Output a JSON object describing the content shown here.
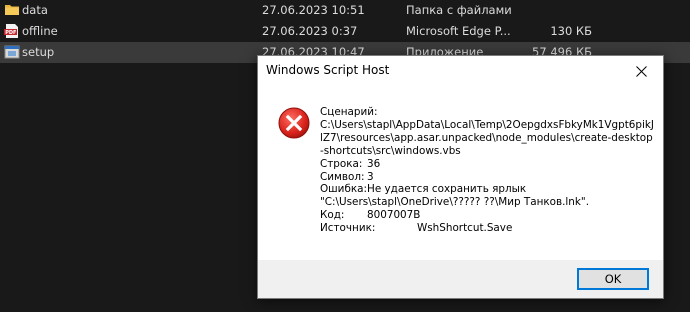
{
  "explorer": {
    "rows": [
      {
        "name": "data",
        "date": "27.06.2023 10:51",
        "type": "Папка с файлами",
        "size": "",
        "icon": "folder-icon"
      },
      {
        "name": "offline",
        "date": "27.06.2023 0:37",
        "type": "Microsoft Edge P...",
        "size": "130 КБ",
        "icon": "pdf-icon"
      },
      {
        "name": "setup",
        "date": "27.06.2023 10:47",
        "type": "Приложение",
        "size": "57 496 КБ",
        "icon": "setup-app-icon"
      }
    ]
  },
  "dialog": {
    "title": "Windows Script Host",
    "scenario_label": "Сценарий:",
    "script_path": "C:\\Users\\stapl\\AppData\\Local\\Temp\\2OepgdxsFbkyMk1Vgpt6pikJlZ7\\resources\\app.asar.unpacked\\node_modules\\create-desktop-shortcuts\\src\\windows.vbs",
    "line_label": "Строка:",
    "line_value": "36",
    "char_label": "Символ:",
    "char_value": "3",
    "error_label": "Ошибка:",
    "error_text": "Не удается сохранить ярлык",
    "error_path": "\"C:\\Users\\stapl\\OneDrive\\????? ??\\Мир Танков.lnk\".",
    "code_label": "Код:",
    "code_value": "8007007B",
    "source_label": "Источник:",
    "source_value": "WshShortcut.Save",
    "ok_label": "OK"
  },
  "colors": {
    "explorer_bg": "#191919",
    "selected_row": "#3a3a3a",
    "error_red": "#e81123",
    "accent": "#0078d7"
  }
}
